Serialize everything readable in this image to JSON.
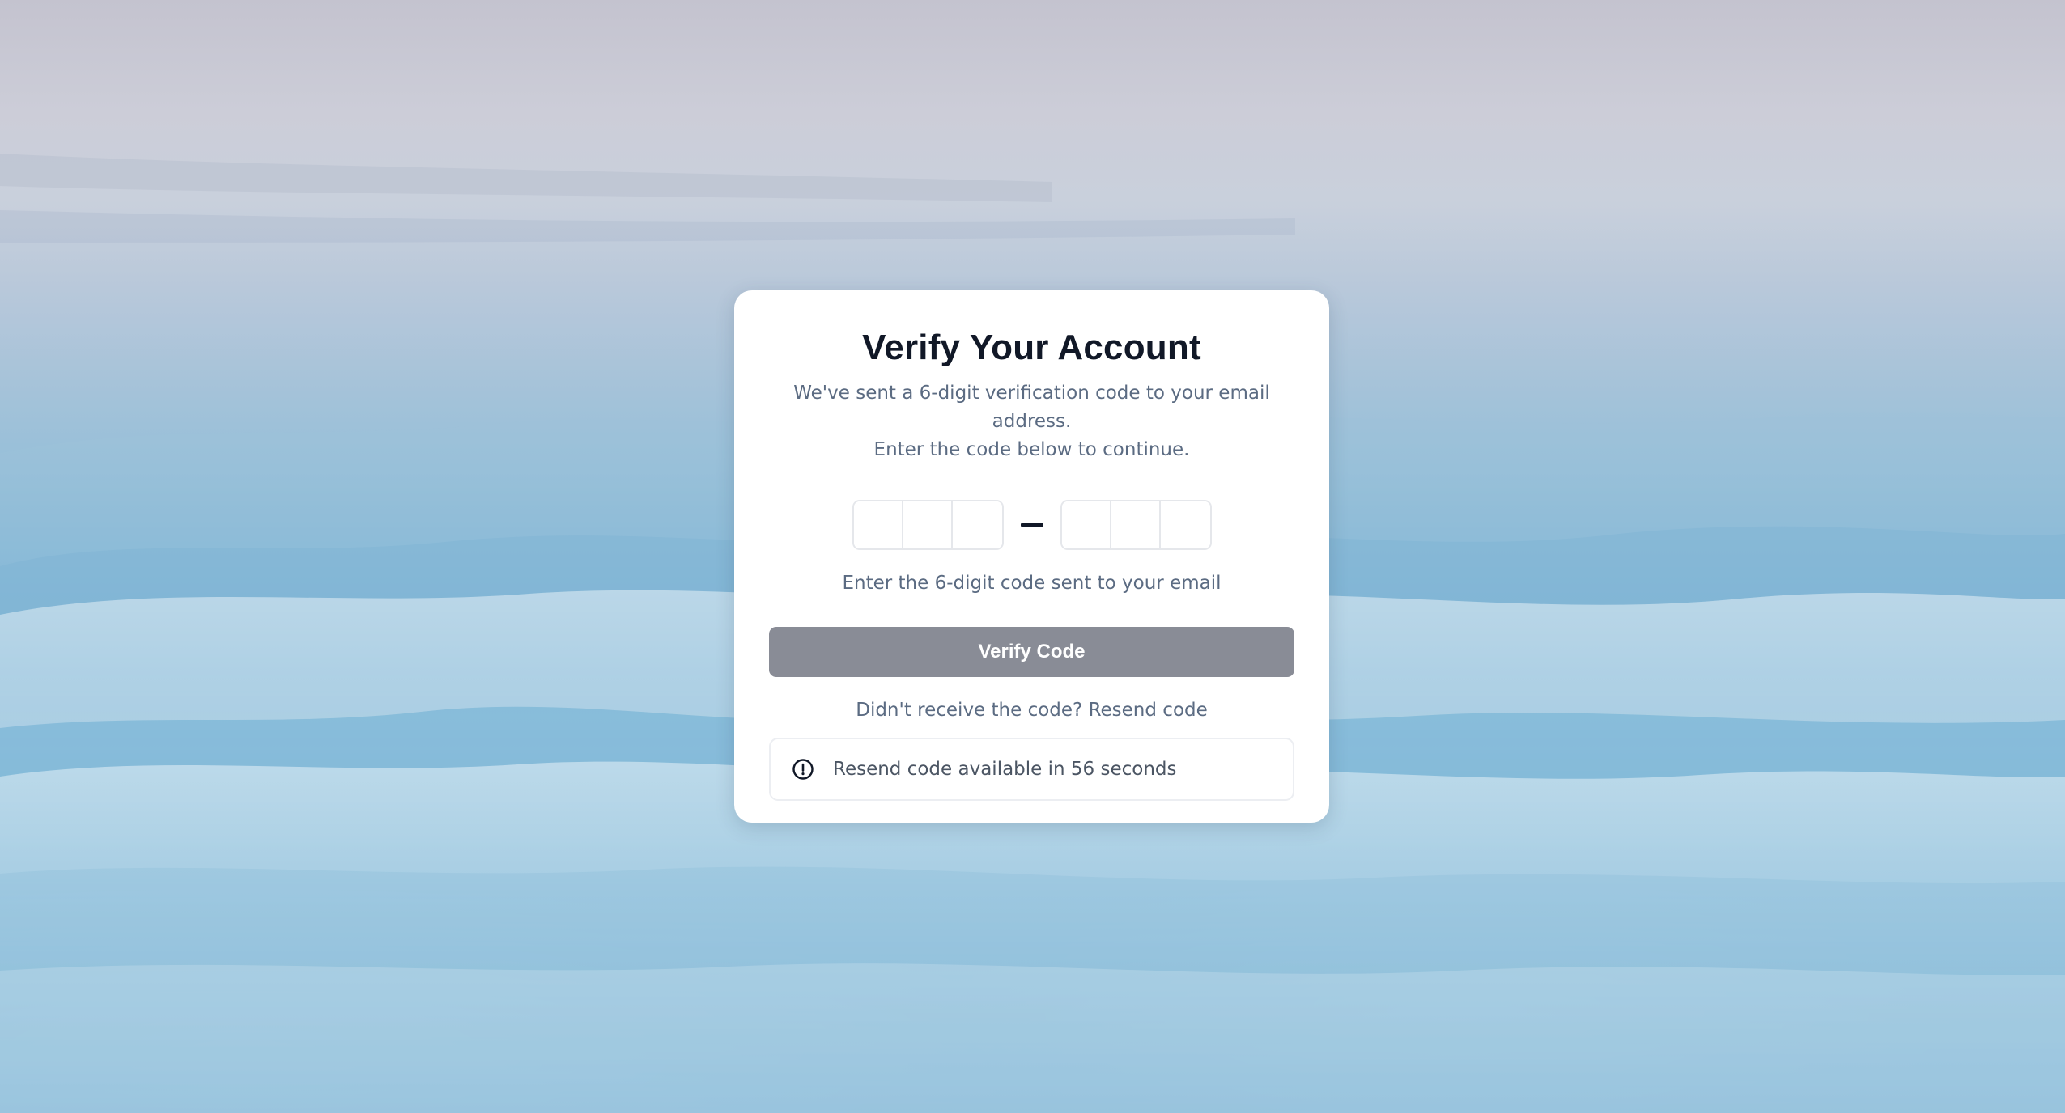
{
  "page": {
    "background": "misty blue mountain ranges under overcast sky"
  },
  "card": {
    "title": "Verify Your Account",
    "subtitle_line1": "We've sent a 6-digit verification code to your email address.",
    "subtitle_line2": "Enter the code below to continue.",
    "otp": {
      "digits": [
        "",
        "",
        "",
        "",
        "",
        ""
      ],
      "separator": "—"
    },
    "hint": "Enter the 6-digit code sent to your email",
    "verify_button": {
      "label": "Verify Code",
      "state": "disabled"
    },
    "resend_prompt": "Didn't receive the code?",
    "resend_link": "Resend code",
    "notice": {
      "icon": "alert-circle-icon",
      "text": "Resend code available in 56 seconds"
    }
  },
  "colors": {
    "title": "#111827",
    "muted_text": "#5b6b82",
    "button_disabled": "#898c96",
    "card": "#ffffff"
  }
}
